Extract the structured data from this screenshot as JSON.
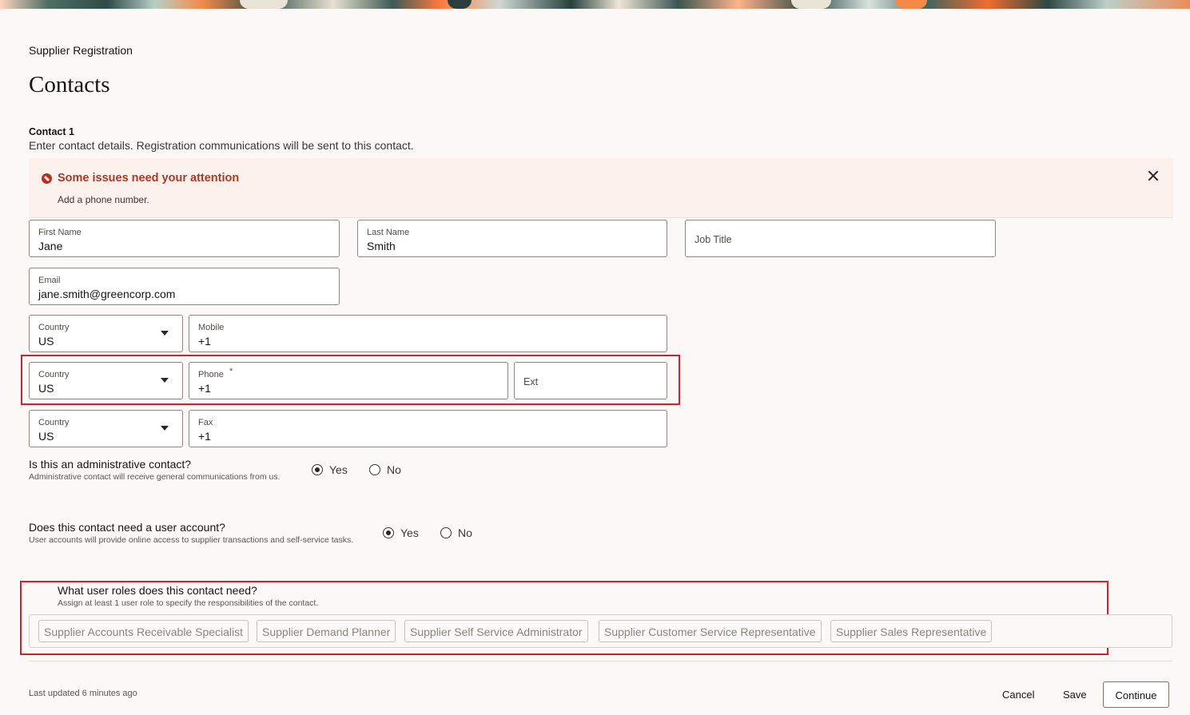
{
  "header": {
    "breadcrumb": "Supplier Registration",
    "title": "Contacts"
  },
  "contact": {
    "heading": "Contact 1",
    "description": "Enter contact details. Registration communications will be sent to this contact."
  },
  "alert": {
    "title": "Some issues need your attention",
    "message": "Add a phone number.",
    "icon": "error-icon"
  },
  "fields": {
    "first_name": {
      "label": "First Name",
      "value": "Jane"
    },
    "last_name": {
      "label": "Last Name",
      "value": "Smith"
    },
    "job_title": {
      "placeholder": "Job Title"
    },
    "email": {
      "label": "Email",
      "value": "jane.smith@greencorp.com"
    },
    "mobile_country": {
      "label": "Country",
      "value": "US"
    },
    "mobile": {
      "label": "Mobile",
      "value": "+1"
    },
    "phone_country": {
      "label": "Country",
      "value": "US"
    },
    "phone": {
      "label": "Phone",
      "value": "+1",
      "required_mark": "*"
    },
    "ext": {
      "placeholder": "Ext"
    },
    "fax_country": {
      "label": "Country",
      "value": "US"
    },
    "fax": {
      "label": "Fax",
      "value": "+1"
    }
  },
  "admin_question": {
    "title": "Is this an administrative contact?",
    "help": "Administrative contact will receive general communications from us.",
    "options": [
      "Yes",
      "No"
    ],
    "selected": "Yes"
  },
  "account_question": {
    "title": "Does this contact need a user account?",
    "help": "User accounts will provide online access to supplier transactions and self-service tasks.",
    "options": [
      "Yes",
      "No"
    ],
    "selected": "Yes"
  },
  "roles": {
    "title": "What user roles does this contact need?",
    "help": "Assign at least 1 user role to specify the responsibilities of the contact.",
    "items": [
      "Supplier Accounts Receivable Specialist",
      "Supplier Demand Planner",
      "Supplier Self Service Administrator",
      "Supplier Customer Service Representative",
      "Supplier Sales Representative"
    ]
  },
  "footer": {
    "last_updated": "Last updated 6 minutes ago",
    "cancel": "Cancel",
    "save": "Save",
    "continue": "Continue"
  },
  "colors": {
    "alert_bg": "#fdf1ee",
    "alert_text": "#a63a26",
    "highlight_border": "#d1202f"
  }
}
